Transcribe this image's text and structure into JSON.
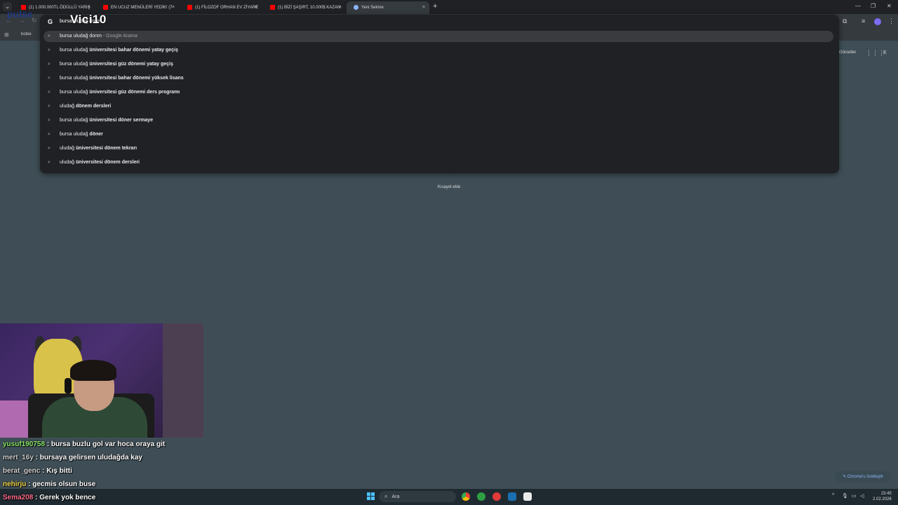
{
  "stream": {
    "title": "Vici10",
    "logo_text": "pulse"
  },
  "tabs": [
    {
      "label": "(1) 1.000.000TL ÖDÜLLÜ YARIŞ",
      "close": "×"
    },
    {
      "label": "EN UCUZ MENÜLERİ YEDİK! (7",
      "close": "×"
    },
    {
      "label": "(1) FİLOZOF ORHAN EV ZİYARE",
      "close": "×"
    },
    {
      "label": "(1) BİZİ ŞAŞIRT, 10.000$ KAZAN",
      "close": "×"
    },
    {
      "label": "Yeni Sekme",
      "close": "×"
    }
  ],
  "tabstrip": {
    "menu": "⌄",
    "new_tab": "+",
    "minimize": "—",
    "restore": "❐",
    "close": "✕"
  },
  "bookmarks": {
    "apps_icon": "⊞",
    "item": "bobie"
  },
  "omnibox": {
    "g_icon": "G",
    "input": "bursa uludağ donm",
    "suggestions": [
      {
        "prefix": "bursa uludağ donm",
        "bold": "",
        "hint": " - Google Arama"
      },
      {
        "prefix": "bursa uludağ ",
        "bold": "üniversitesi bahar dönemi yatay geçiş",
        "hint": ""
      },
      {
        "prefix": "bursa uludağ ",
        "bold": "üniversitesi güz dönemi yatay geçiş",
        "hint": ""
      },
      {
        "prefix": "bursa uludağ ",
        "bold": "üniversitesi bahar dönemi yüksek lisans",
        "hint": ""
      },
      {
        "prefix": "bursa uludağ ",
        "bold": "üniversitesi güz dönemi ders programı",
        "hint": ""
      },
      {
        "prefix": "uludağ ",
        "bold": "dönem dersleri",
        "hint": ""
      },
      {
        "prefix": "bursa uludağ ",
        "bold": "üniversitesi döner sermaye",
        "hint": ""
      },
      {
        "prefix": "bursa uludağ ",
        "bold": "döner",
        "hint": ""
      },
      {
        "prefix": "uludağ ",
        "bold": "üniversitesi dönem tekrarı",
        "hint": ""
      },
      {
        "prefix": "uludağ ",
        "bold": "üniversitesi dönem dersleri",
        "hint": ""
      }
    ]
  },
  "page": {
    "gorseller": "Görseller",
    "apps_icon": "⋮⋮⋮",
    "account_initial": "E",
    "shortcut_add": "Kısayol ekle",
    "customize": "✎ Chrome'u özelleştir"
  },
  "chat": [
    {
      "user": "yusuf190758",
      "text": " : bursa buzlu gol var hoca oraya git"
    },
    {
      "user": "mert_16y",
      "text": " : bursaya gelirsen uludağda kay"
    },
    {
      "user": "berat_genc",
      "text": " : Kış bitti"
    },
    {
      "user": "nehirju",
      "text": " : gecmis olsun buse"
    },
    {
      "user": "Sema208",
      "text": " : Gerek yok bence"
    }
  ],
  "taskbar": {
    "search_placeholder": "Ara",
    "time": "23:45",
    "date": "2.02.2026",
    "tray_arrow": "^"
  },
  "colors": {
    "page_bg": "#3f4e56",
    "omnibox_bg": "#202124",
    "accent": "#8ab4f8"
  }
}
